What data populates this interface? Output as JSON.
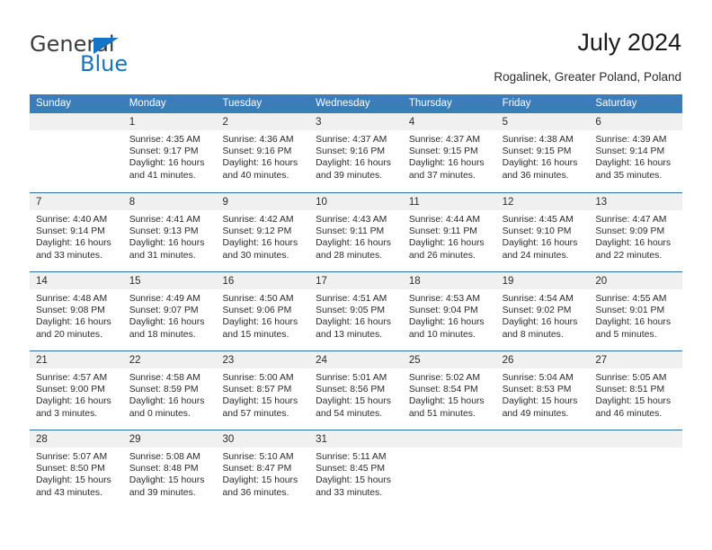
{
  "brand": {
    "name_top": "General",
    "name_bottom": "Blue",
    "accent_color": "#1773c4"
  },
  "header": {
    "title": "July 2024",
    "subtitle": "Rogalinek, Greater Poland, Poland"
  },
  "theme": {
    "header_blue": "#3b7cb9",
    "row_border_blue": "#2e6da4",
    "daynum_band": "#f0f0f0",
    "text": "#2b2b2b"
  },
  "calendar": {
    "weekdays": [
      "Sunday",
      "Monday",
      "Tuesday",
      "Wednesday",
      "Thursday",
      "Friday",
      "Saturday"
    ],
    "weeks": [
      [
        {
          "day": "",
          "lines": []
        },
        {
          "day": "1",
          "lines": [
            "Sunrise: 4:35 AM",
            "Sunset: 9:17 PM",
            "Daylight: 16 hours",
            "and 41 minutes."
          ]
        },
        {
          "day": "2",
          "lines": [
            "Sunrise: 4:36 AM",
            "Sunset: 9:16 PM",
            "Daylight: 16 hours",
            "and 40 minutes."
          ]
        },
        {
          "day": "3",
          "lines": [
            "Sunrise: 4:37 AM",
            "Sunset: 9:16 PM",
            "Daylight: 16 hours",
            "and 39 minutes."
          ]
        },
        {
          "day": "4",
          "lines": [
            "Sunrise: 4:37 AM",
            "Sunset: 9:15 PM",
            "Daylight: 16 hours",
            "and 37 minutes."
          ]
        },
        {
          "day": "5",
          "lines": [
            "Sunrise: 4:38 AM",
            "Sunset: 9:15 PM",
            "Daylight: 16 hours",
            "and 36 minutes."
          ]
        },
        {
          "day": "6",
          "lines": [
            "Sunrise: 4:39 AM",
            "Sunset: 9:14 PM",
            "Daylight: 16 hours",
            "and 35 minutes."
          ]
        }
      ],
      [
        {
          "day": "7",
          "lines": [
            "Sunrise: 4:40 AM",
            "Sunset: 9:14 PM",
            "Daylight: 16 hours",
            "and 33 minutes."
          ]
        },
        {
          "day": "8",
          "lines": [
            "Sunrise: 4:41 AM",
            "Sunset: 9:13 PM",
            "Daylight: 16 hours",
            "and 31 minutes."
          ]
        },
        {
          "day": "9",
          "lines": [
            "Sunrise: 4:42 AM",
            "Sunset: 9:12 PM",
            "Daylight: 16 hours",
            "and 30 minutes."
          ]
        },
        {
          "day": "10",
          "lines": [
            "Sunrise: 4:43 AM",
            "Sunset: 9:11 PM",
            "Daylight: 16 hours",
            "and 28 minutes."
          ]
        },
        {
          "day": "11",
          "lines": [
            "Sunrise: 4:44 AM",
            "Sunset: 9:11 PM",
            "Daylight: 16 hours",
            "and 26 minutes."
          ]
        },
        {
          "day": "12",
          "lines": [
            "Sunrise: 4:45 AM",
            "Sunset: 9:10 PM",
            "Daylight: 16 hours",
            "and 24 minutes."
          ]
        },
        {
          "day": "13",
          "lines": [
            "Sunrise: 4:47 AM",
            "Sunset: 9:09 PM",
            "Daylight: 16 hours",
            "and 22 minutes."
          ]
        }
      ],
      [
        {
          "day": "14",
          "lines": [
            "Sunrise: 4:48 AM",
            "Sunset: 9:08 PM",
            "Daylight: 16 hours",
            "and 20 minutes."
          ]
        },
        {
          "day": "15",
          "lines": [
            "Sunrise: 4:49 AM",
            "Sunset: 9:07 PM",
            "Daylight: 16 hours",
            "and 18 minutes."
          ]
        },
        {
          "day": "16",
          "lines": [
            "Sunrise: 4:50 AM",
            "Sunset: 9:06 PM",
            "Daylight: 16 hours",
            "and 15 minutes."
          ]
        },
        {
          "day": "17",
          "lines": [
            "Sunrise: 4:51 AM",
            "Sunset: 9:05 PM",
            "Daylight: 16 hours",
            "and 13 minutes."
          ]
        },
        {
          "day": "18",
          "lines": [
            "Sunrise: 4:53 AM",
            "Sunset: 9:04 PM",
            "Daylight: 16 hours",
            "and 10 minutes."
          ]
        },
        {
          "day": "19",
          "lines": [
            "Sunrise: 4:54 AM",
            "Sunset: 9:02 PM",
            "Daylight: 16 hours",
            "and 8 minutes."
          ]
        },
        {
          "day": "20",
          "lines": [
            "Sunrise: 4:55 AM",
            "Sunset: 9:01 PM",
            "Daylight: 16 hours",
            "and 5 minutes."
          ]
        }
      ],
      [
        {
          "day": "21",
          "lines": [
            "Sunrise: 4:57 AM",
            "Sunset: 9:00 PM",
            "Daylight: 16 hours",
            "and 3 minutes."
          ]
        },
        {
          "day": "22",
          "lines": [
            "Sunrise: 4:58 AM",
            "Sunset: 8:59 PM",
            "Daylight: 16 hours",
            "and 0 minutes."
          ]
        },
        {
          "day": "23",
          "lines": [
            "Sunrise: 5:00 AM",
            "Sunset: 8:57 PM",
            "Daylight: 15 hours",
            "and 57 minutes."
          ]
        },
        {
          "day": "24",
          "lines": [
            "Sunrise: 5:01 AM",
            "Sunset: 8:56 PM",
            "Daylight: 15 hours",
            "and 54 minutes."
          ]
        },
        {
          "day": "25",
          "lines": [
            "Sunrise: 5:02 AM",
            "Sunset: 8:54 PM",
            "Daylight: 15 hours",
            "and 51 minutes."
          ]
        },
        {
          "day": "26",
          "lines": [
            "Sunrise: 5:04 AM",
            "Sunset: 8:53 PM",
            "Daylight: 15 hours",
            "and 49 minutes."
          ]
        },
        {
          "day": "27",
          "lines": [
            "Sunrise: 5:05 AM",
            "Sunset: 8:51 PM",
            "Daylight: 15 hours",
            "and 46 minutes."
          ]
        }
      ],
      [
        {
          "day": "28",
          "lines": [
            "Sunrise: 5:07 AM",
            "Sunset: 8:50 PM",
            "Daylight: 15 hours",
            "and 43 minutes."
          ]
        },
        {
          "day": "29",
          "lines": [
            "Sunrise: 5:08 AM",
            "Sunset: 8:48 PM",
            "Daylight: 15 hours",
            "and 39 minutes."
          ]
        },
        {
          "day": "30",
          "lines": [
            "Sunrise: 5:10 AM",
            "Sunset: 8:47 PM",
            "Daylight: 15 hours",
            "and 36 minutes."
          ]
        },
        {
          "day": "31",
          "lines": [
            "Sunrise: 5:11 AM",
            "Sunset: 8:45 PM",
            "Daylight: 15 hours",
            "and 33 minutes."
          ]
        },
        {
          "day": "",
          "lines": []
        },
        {
          "day": "",
          "lines": []
        },
        {
          "day": "",
          "lines": []
        }
      ]
    ]
  }
}
